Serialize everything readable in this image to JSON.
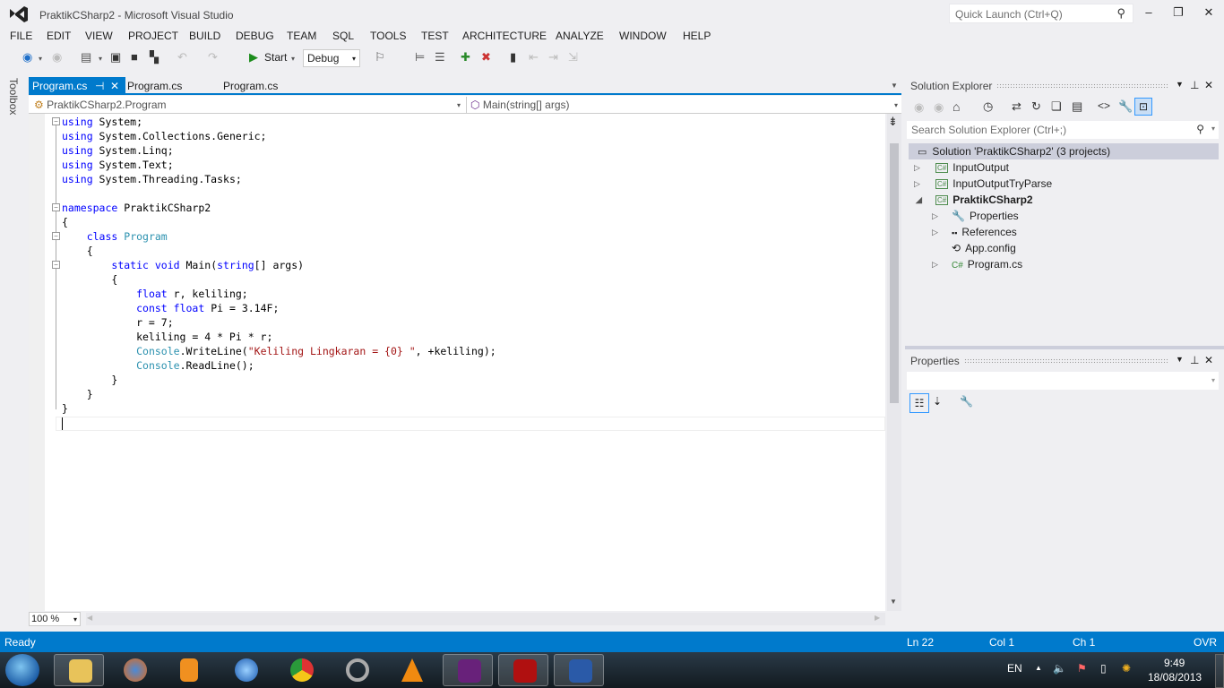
{
  "window": {
    "title": "PraktikCSharp2 - Microsoft Visual Studio",
    "quick_launch_placeholder": "Quick Launch (Ctrl+Q)",
    "minimize": "‒",
    "restore": "❐",
    "close": "✕"
  },
  "menu": [
    "FILE",
    "EDIT",
    "VIEW",
    "PROJECT",
    "BUILD",
    "DEBUG",
    "TEAM",
    "SQL",
    "TOOLS",
    "TEST",
    "ARCHITECTURE",
    "ANALYZE",
    "WINDOW",
    "HELP"
  ],
  "toolbar": {
    "start_label": "Start",
    "config": "Debug"
  },
  "toolbox_label": "Toolbox",
  "tabs": [
    {
      "label": "Program.cs",
      "active": true,
      "pin": "⊣",
      "close": "✕"
    },
    {
      "label": "Program.cs"
    },
    {
      "label": "Program.cs"
    }
  ],
  "navbar": {
    "type_dropdown": "PraktikCSharp2.Program",
    "member_dropdown": "Main(string[] args)"
  },
  "code_lines": [
    "using System;",
    "using System.Collections.Generic;",
    "using System.Linq;",
    "using System.Text;",
    "using System.Threading.Tasks;",
    "",
    "namespace PraktikCSharp2",
    "{",
    "    class Program",
    "    {",
    "        static void Main(string[] args)",
    "        {",
    "            float r, keliling;",
    "            const float Pi = 3.14F;",
    "            r = 7;",
    "            keliling = 4 * Pi * r;",
    "            Console.WriteLine(\"Keliling Lingkaran = {0} \", +keliling);",
    "            Console.ReadLine();",
    "        }",
    "    }",
    "}",
    ""
  ],
  "editor": {
    "zoom_level": "100 %"
  },
  "solution_explorer": {
    "title": "Solution Explorer",
    "search_placeholder": "Search Solution Explorer (Ctrl+;)",
    "solution": "Solution 'PraktikCSharp2' (3 projects)",
    "items": [
      {
        "label": "InputOutput",
        "type": "project"
      },
      {
        "label": "InputOutputTryParse",
        "type": "project"
      },
      {
        "label": "PraktikCSharp2",
        "type": "project",
        "expanded": true,
        "bold": true
      },
      {
        "label": "Properties",
        "type": "folder"
      },
      {
        "label": "References",
        "type": "references"
      },
      {
        "label": "App.config",
        "type": "config"
      },
      {
        "label": "Program.cs",
        "type": "cs-file"
      }
    ]
  },
  "properties": {
    "title": "Properties"
  },
  "status": {
    "state": "Ready",
    "line": "Ln 22",
    "col": "Col 1",
    "ch": "Ch 1",
    "mode": "OVR"
  },
  "taskbar": {
    "apps": [
      "start",
      "explorer",
      "firefox",
      "media-player",
      "itunes",
      "chrome",
      "picasa",
      "vlc",
      "visual-studio",
      "acrobat",
      "word"
    ],
    "language": "EN",
    "time": "9:49",
    "date": "18/08/2013"
  },
  "colors": {
    "accent": "#007acc",
    "keyword": "#0000ff",
    "type": "#2b91af",
    "string": "#a31515"
  }
}
